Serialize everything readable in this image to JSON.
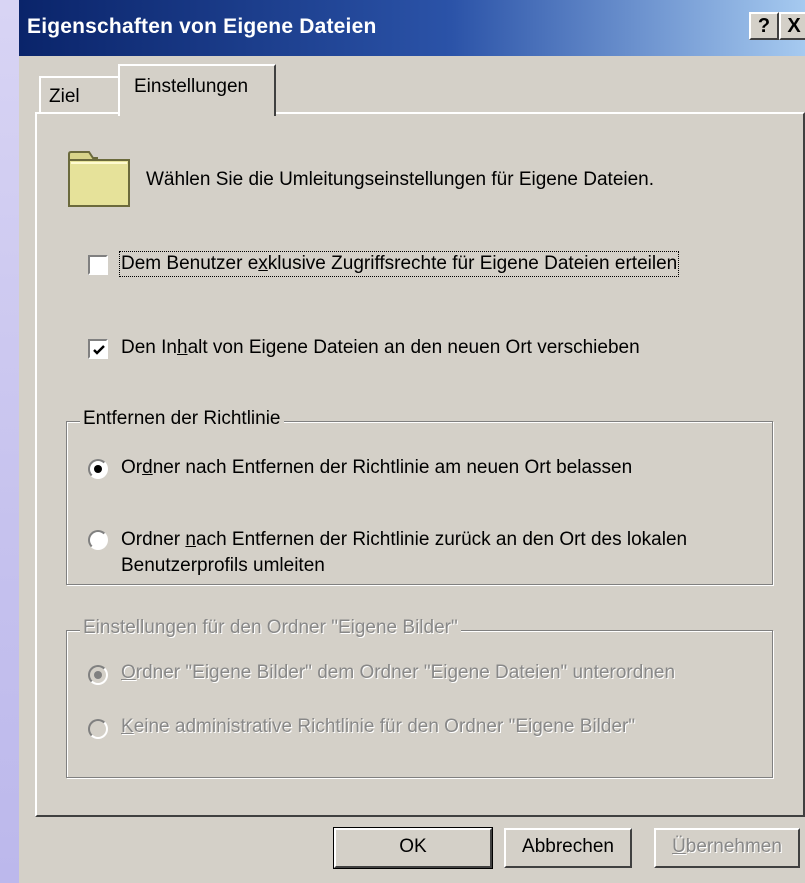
{
  "window": {
    "title": "Eigenschaften von Eigene Dateien",
    "help_button": "?",
    "close_button": "X"
  },
  "tabs": [
    {
      "label": "Ziel",
      "active": false
    },
    {
      "label": "Einstellungen",
      "active": true
    }
  ],
  "intro_text": "Wählen Sie die Umleitungseinstellungen für Eigene Dateien.",
  "options": {
    "exclusive_rights": {
      "pre": "Dem Benutzer e",
      "mnemonic": "x",
      "post": "klusive Zugriffsrechte für Eigene Dateien erteilen",
      "checked": false
    },
    "move_contents": {
      "pre": "Den In",
      "mnemonic": "h",
      "post": "alt von Eigene Dateien an den neuen Ort verschieben",
      "checked": true
    }
  },
  "policy_removal": {
    "title": "Entfernen der Richtlinie",
    "leave": {
      "pre": "Or",
      "mnemonic": "d",
      "post": "ner nach Entfernen der Richtlinie am neuen Ort belassen",
      "selected": true
    },
    "redirect": {
      "pre": "Ordner ",
      "mnemonic": "n",
      "post": "ach Entfernen der Richtlinie zurück an den Ort des lokalen",
      "line2": "Benutzerprofils umleiten",
      "selected": false
    }
  },
  "pictures_folder": {
    "title": "Einstellungen für den Ordner \"Eigene Bilder\"",
    "subordinate": {
      "mnemonic": "O",
      "post": "rdner \"Eigene Bilder\" dem Ordner \"Eigene Dateien\" unterordnen",
      "selected": true,
      "disabled": true
    },
    "no_policy": {
      "mnemonic": "K",
      "post": "eine administrative Richtlinie für den Ordner \"Eigene Bilder\"",
      "selected": false,
      "disabled": true
    }
  },
  "buttons": {
    "ok": "OK",
    "cancel": "Abbrechen",
    "apply": {
      "mnemonic": "Ü",
      "post": "bernehmen",
      "disabled": true
    }
  },
  "colors": {
    "titlebar_start": "#0a246a",
    "titlebar_end": "#a6caf0",
    "face": "#d4d0c8",
    "folder": "#e6e29a"
  },
  "icons": [
    "folder-icon",
    "checkmark-icon",
    "help-icon",
    "close-icon"
  ]
}
